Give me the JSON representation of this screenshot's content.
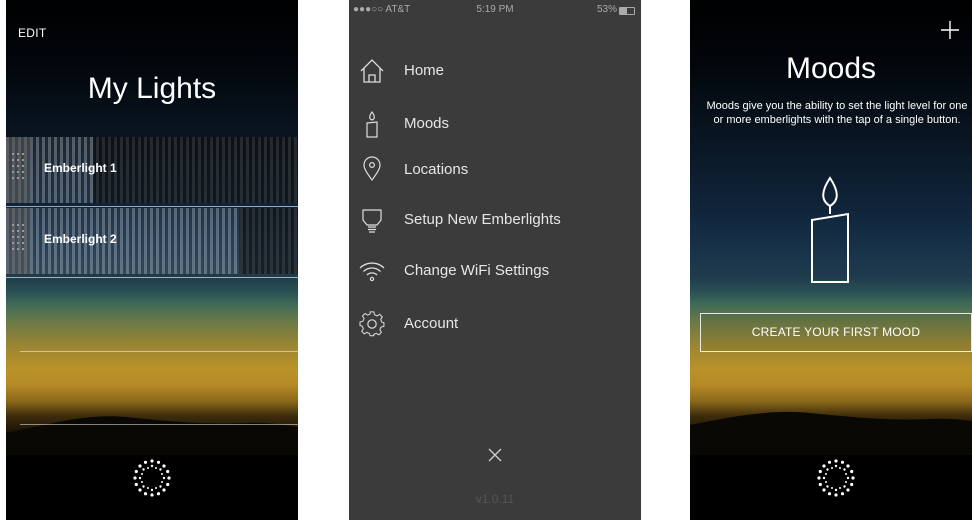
{
  "screen_lights": {
    "edit_label": "EDIT",
    "title": "My Lights",
    "lights": [
      {
        "name": "Emberlight 1",
        "level": 0.3
      },
      {
        "name": "Emberlight 2",
        "level": 0.8
      }
    ]
  },
  "screen_menu": {
    "status": {
      "carrier": "●●●○○ AT&T",
      "time": "5:19 PM",
      "battery": "53%"
    },
    "items": [
      {
        "label": "Home",
        "icon": "home-icon"
      },
      {
        "label": "Moods",
        "icon": "candle-icon"
      },
      {
        "label": "Locations",
        "icon": "location-pin-icon"
      },
      {
        "label": "Setup New Emberlights",
        "icon": "bulb-icon"
      },
      {
        "label": "Change WiFi Settings",
        "icon": "wifi-icon"
      },
      {
        "label": "Account",
        "icon": "gear-icon"
      }
    ],
    "version": "v1.0.11"
  },
  "screen_moods": {
    "title": "Moods",
    "description": "Moods give you the ability to set the light level for one or more emberlights with the tap of a single button.",
    "create_button": "CREATE YOUR FIRST MOOD"
  },
  "colors": {
    "menu_bg": "#3b3b3b",
    "text": "#ffffff"
  }
}
